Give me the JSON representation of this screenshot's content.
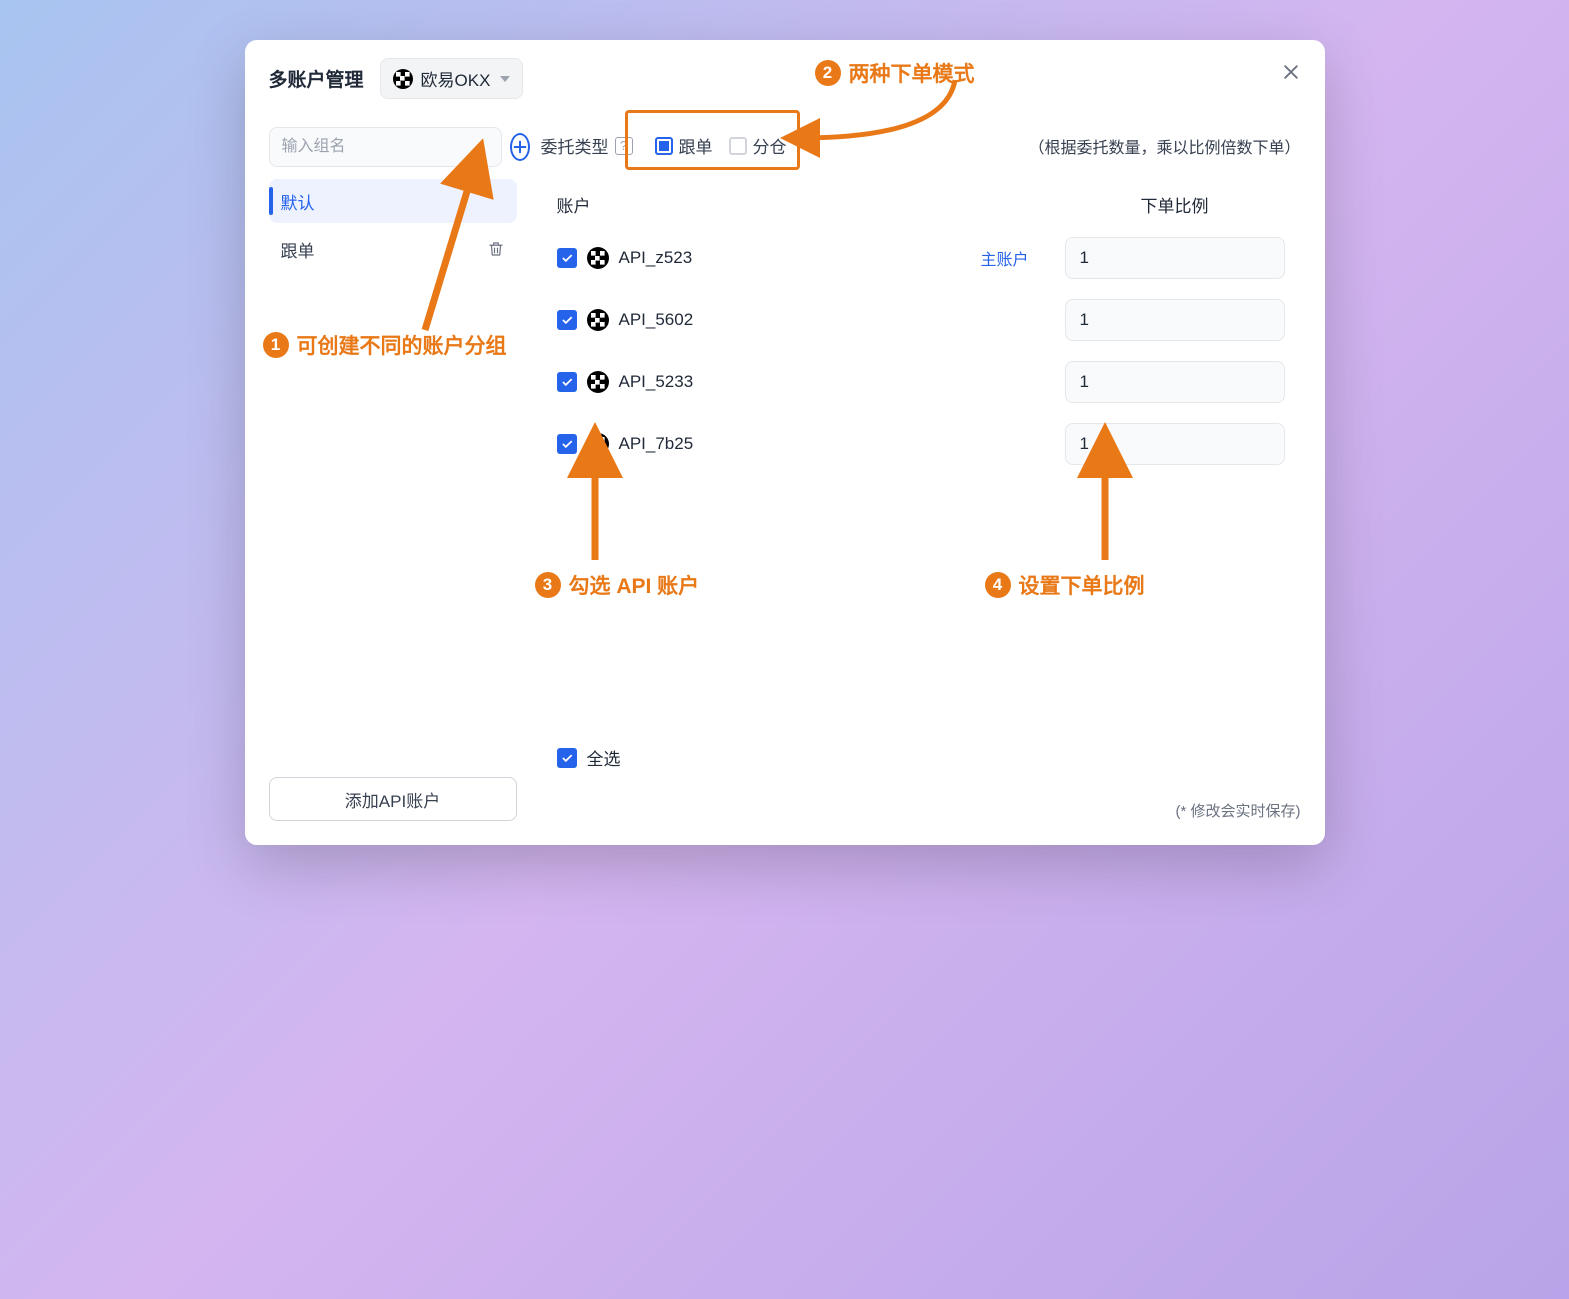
{
  "header": {
    "title": "多账户管理",
    "exchange_label": "欧易OKX"
  },
  "sidebar": {
    "group_input_placeholder": "输入组名",
    "groups": [
      {
        "name": "默认",
        "active": true,
        "deletable": false
      },
      {
        "name": "跟单",
        "active": false,
        "deletable": true
      }
    ],
    "add_api_button": "添加API账户"
  },
  "main": {
    "order_type_label": "委托类型",
    "order_type_options": [
      {
        "label": "跟单",
        "checked": true
      },
      {
        "label": "分仓",
        "checked": false
      }
    ],
    "hint": "（根据委托数量，乘以比例倍数下单）",
    "table": {
      "header_account": "账户",
      "header_ratio": "下单比例",
      "main_account_label": "主账户",
      "rows": [
        {
          "name": "API_z523",
          "is_main": true,
          "ratio": "1",
          "checked": true
        },
        {
          "name": "API_5602",
          "is_main": false,
          "ratio": "1",
          "checked": true
        },
        {
          "name": "API_5233",
          "is_main": false,
          "ratio": "1",
          "checked": true
        },
        {
          "name": "API_7b25",
          "is_main": false,
          "ratio": "1",
          "checked": true
        }
      ],
      "select_all_label": "全选"
    },
    "footer_hint": "(* 修改会实时保存)"
  },
  "annotations": {
    "a1": "可创建不同的账户分组",
    "a2": "两种下单模式",
    "a3": "勾选 API 账户",
    "a4": "设置下单比例"
  }
}
